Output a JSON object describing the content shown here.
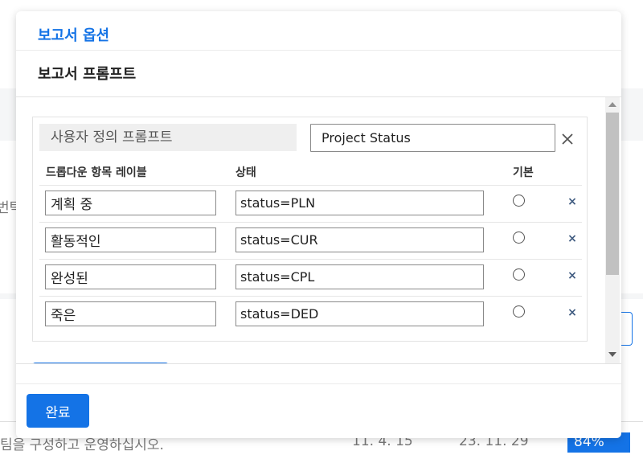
{
  "background": {
    "left_text": "번탁",
    "row_text": "팀을 구성하고 운영하십시오.",
    "date1": "11. 4. 15",
    "date2": "23. 11. 29",
    "percent": "84%"
  },
  "modal": {
    "title": "보고서 옵션",
    "section_title": "보고서 프롬프트",
    "prompt": {
      "label": "사용자 정의 프롬프트",
      "name_value": "Project Status",
      "close_icon": "close-icon"
    },
    "columns": {
      "label": "드롭다운 항목 레이블",
      "status": "상태",
      "default": "기본"
    },
    "rows": [
      {
        "label": "계획 중",
        "value": "status=PLN"
      },
      {
        "label": "활동적인",
        "value": "status=CUR"
      },
      {
        "label": "완성된",
        "value": "status=CPL"
      },
      {
        "label": "죽은",
        "value": "status=DED"
      }
    ],
    "delete_glyph": "×",
    "done_label": "완료"
  },
  "colors": {
    "accent": "#1473e6",
    "delete_icon": "#3f5b80"
  }
}
